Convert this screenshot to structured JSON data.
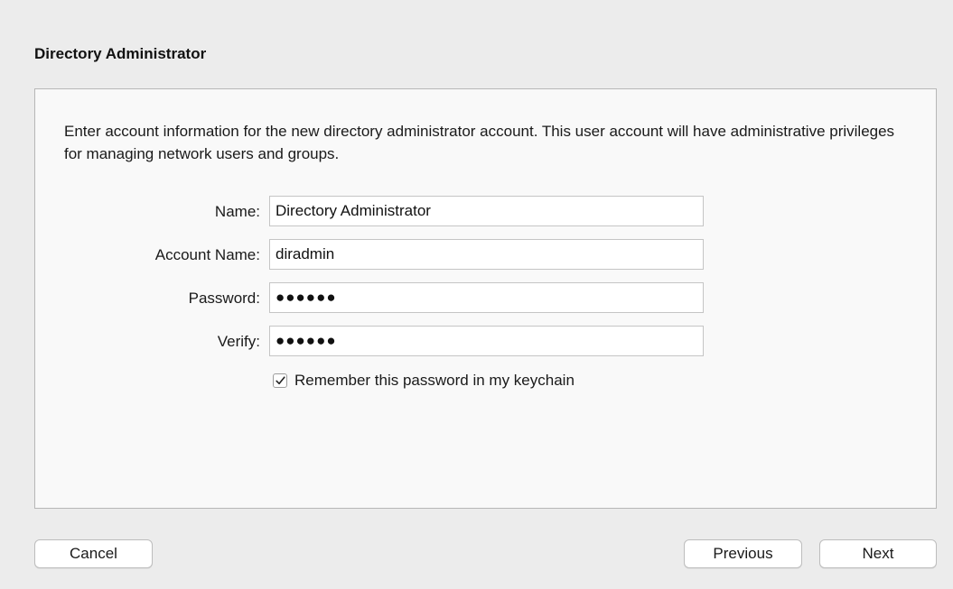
{
  "header": {
    "title": "Directory Administrator"
  },
  "panel": {
    "intro": "Enter account information for the new directory administrator account. This user account will have administrative privileges for managing network users and groups.",
    "fields": {
      "name": {
        "label": "Name:",
        "value": "Directory Administrator"
      },
      "account_name": {
        "label": "Account Name:",
        "value": "diradmin"
      },
      "password": {
        "label": "Password:",
        "value": "●●●●●●"
      },
      "verify": {
        "label": "Verify:",
        "value": "●●●●●●"
      }
    },
    "keychain_checkbox": {
      "label": "Remember this password in my keychain",
      "checked": true
    }
  },
  "footer": {
    "cancel_label": "Cancel",
    "previous_label": "Previous",
    "next_label": "Next"
  },
  "colors": {
    "background": "#ececec",
    "panel_background": "#f9f9f9",
    "panel_border": "#b7b7b7"
  }
}
